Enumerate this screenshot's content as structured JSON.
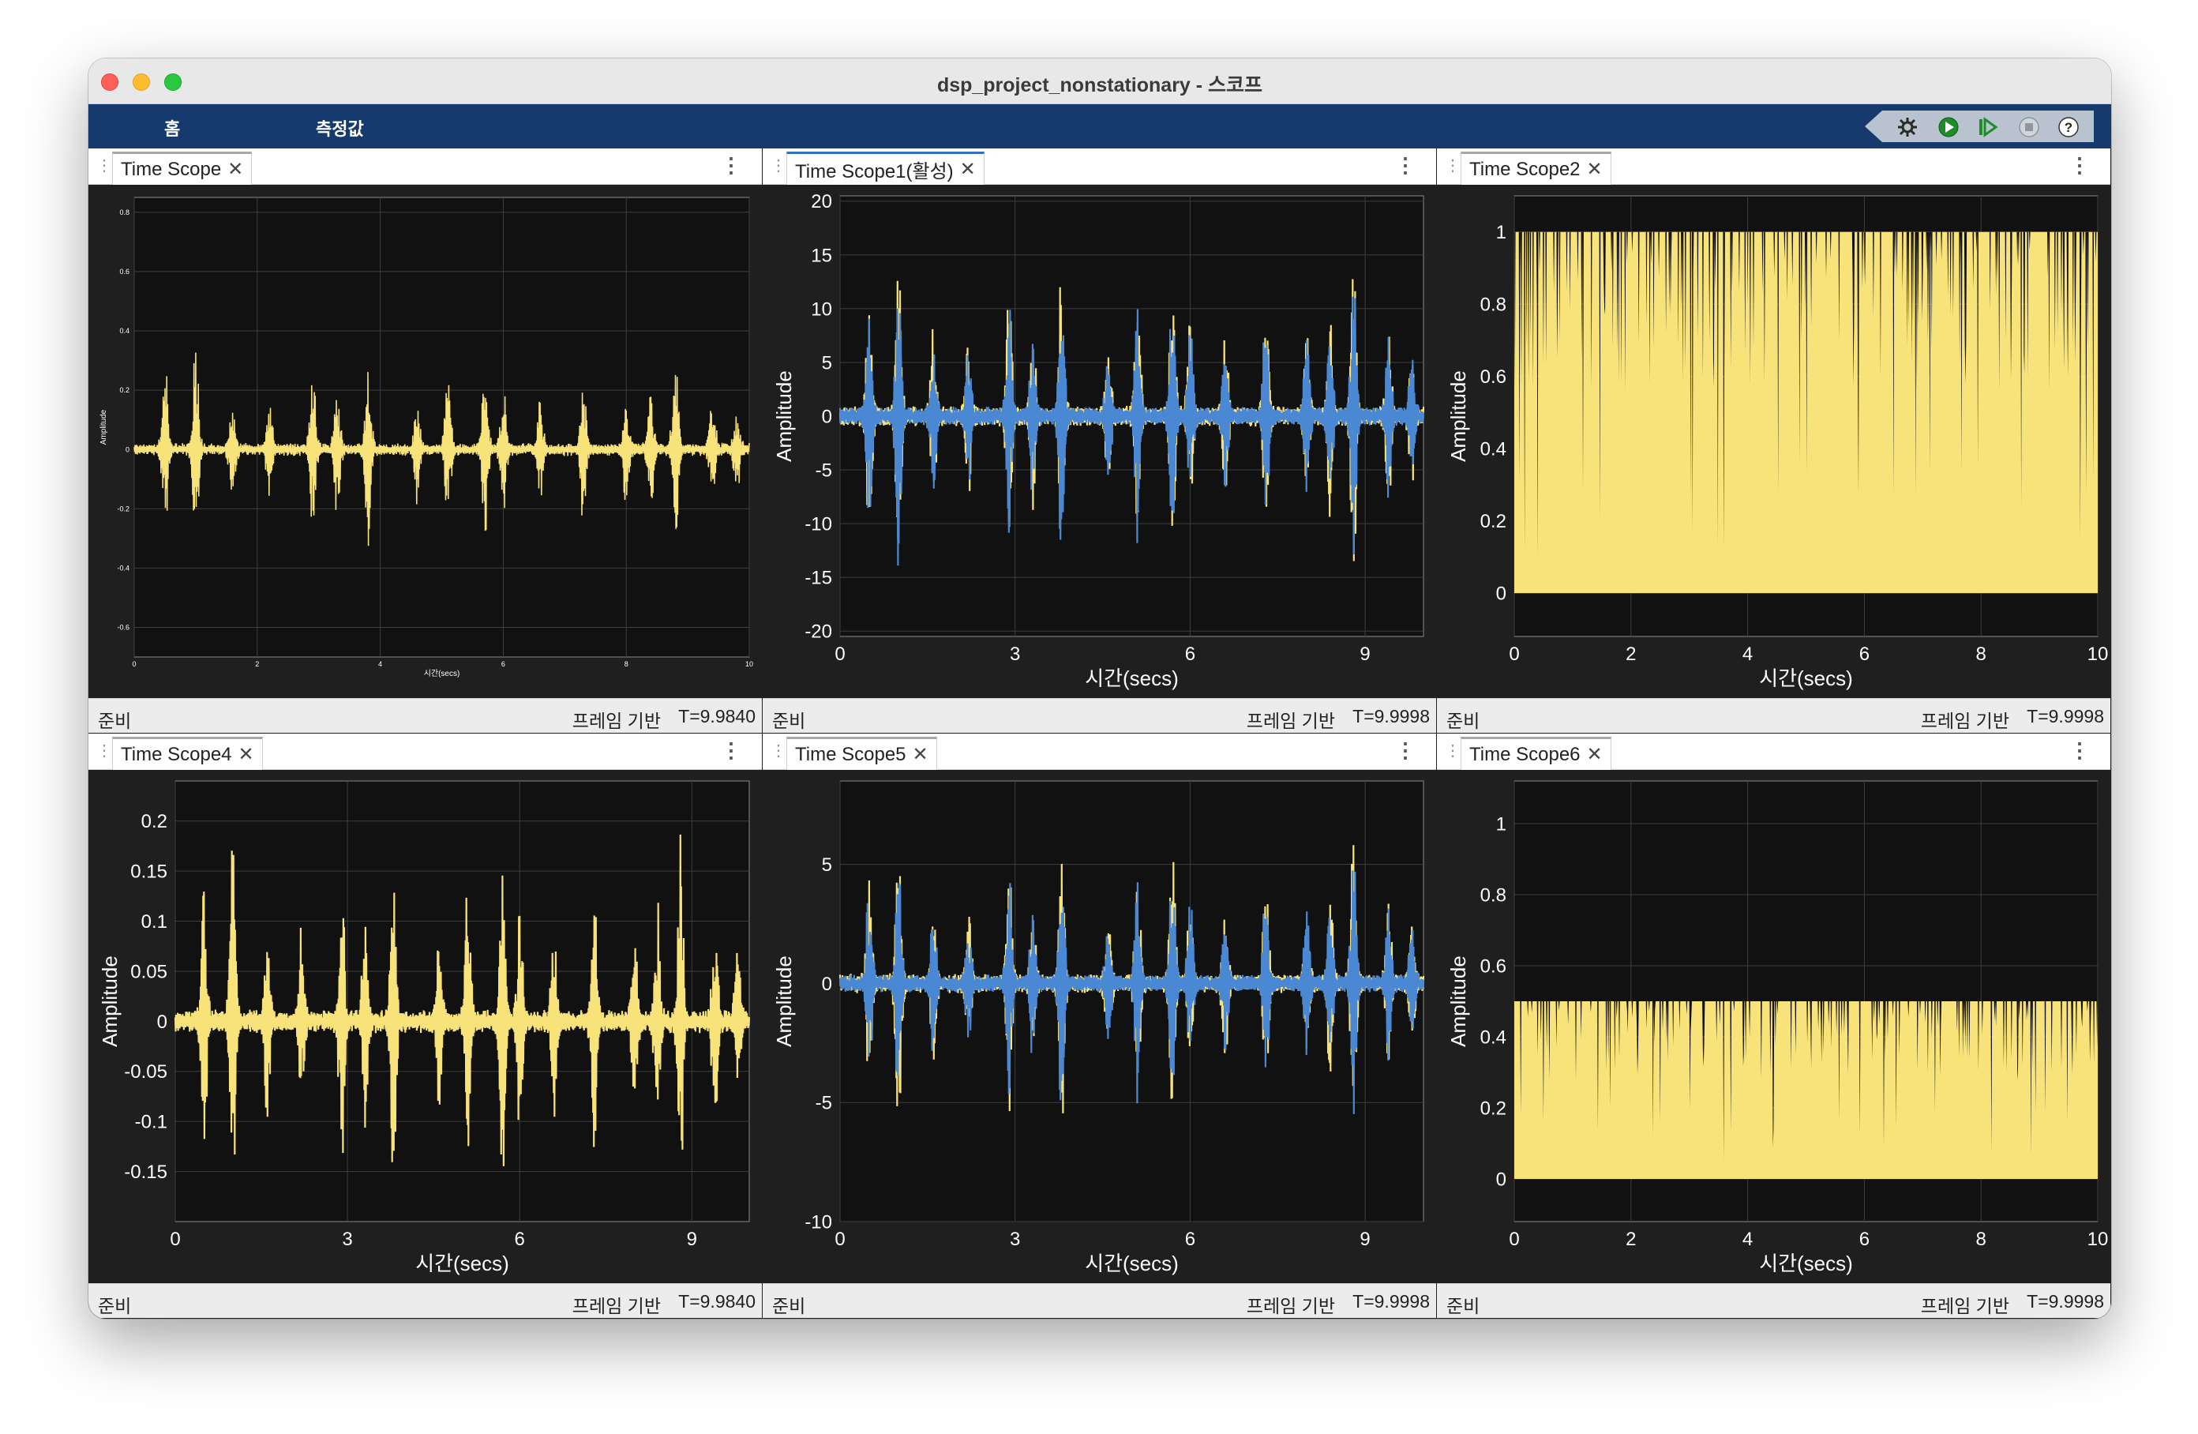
{
  "window": {
    "title": "dsp_project_nonstationary - 스코프"
  },
  "ribbon": {
    "tabs": [
      "홈",
      "측정값"
    ]
  },
  "panes": [
    {
      "tab": "Time Scope",
      "active": false,
      "status_left": "준비",
      "status_mode": "프레임 기반",
      "status_time": "T=9.9840"
    },
    {
      "tab": "Time Scope1(활성)",
      "active": true,
      "status_left": "준비",
      "status_mode": "프레임 기반",
      "status_time": "T=9.9998"
    },
    {
      "tab": "Time Scope2",
      "active": false,
      "status_left": "준비",
      "status_mode": "프레임 기반",
      "status_time": "T=9.9998"
    },
    {
      "tab": "Time Scope4",
      "active": false,
      "status_left": "준비",
      "status_mode": "프레임 기반",
      "status_time": "T=9.9840"
    },
    {
      "tab": "Time Scope5",
      "active": false,
      "status_left": "준비",
      "status_mode": "프레임 기반",
      "status_time": "T=9.9998"
    },
    {
      "tab": "Time Scope6",
      "active": false,
      "status_left": "준비",
      "status_mode": "프레임 기반",
      "status_time": "T=9.9998"
    }
  ],
  "colors": {
    "yellow": "#f8e27a",
    "blue": "#4a88d4",
    "plot_bg": "#111111",
    "axes_bg": "#1f1f1f",
    "grid": "#3e3e3e",
    "text": "#ffffff"
  },
  "chart_data": [
    {
      "type": "line",
      "signal": "speech",
      "xlabel": "시간(secs)",
      "ylabel": "Amplitude",
      "xlim": [
        0,
        10
      ],
      "ylim": [
        -0.7,
        0.85
      ],
      "xticks": [
        0,
        2,
        4,
        6,
        8,
        10
      ],
      "yticks": [
        -0.6,
        -0.4,
        -0.2,
        0,
        0.2,
        0.4,
        0.6,
        0.8
      ],
      "ytick_labels": [
        "-0.6",
        "-0.4",
        "-0.2",
        "0",
        "0.2",
        "0.4",
        "0.6",
        "0.8"
      ],
      "series": [
        {
          "color": "yellow",
          "envelope": 0.38
        }
      ]
    },
    {
      "type": "line",
      "signal": "speech",
      "xlabel": "시간(secs)",
      "ylabel": "Amplitude",
      "xlim": [
        0,
        10
      ],
      "ylim": [
        -20.5,
        20.5
      ],
      "xticks": [
        0,
        3,
        6,
        9
      ],
      "yticks": [
        -20,
        -15,
        -10,
        -5,
        0,
        5,
        10,
        15,
        20
      ],
      "ytick_labels": [
        "-20",
        "-15",
        "-10",
        "-5",
        "0",
        "5",
        "10",
        "15",
        "20"
      ],
      "series": [
        {
          "color": "yellow",
          "envelope": 16.5
        },
        {
          "color": "blue",
          "envelope": 15
        }
      ]
    },
    {
      "type": "area",
      "signal": "mask",
      "xlabel": "시간(secs)",
      "ylabel": "Amplitude",
      "xlim": [
        0,
        10
      ],
      "ylim": [
        -0.12,
        1.1
      ],
      "level": 1.0,
      "xticks": [
        0,
        2,
        4,
        6,
        8,
        10
      ],
      "yticks": [
        0,
        0.2,
        0.4,
        0.6,
        0.8,
        1
      ],
      "ytick_labels": [
        "0",
        "0.2",
        "0.4",
        "0.6",
        "0.8",
        "1"
      ],
      "series": [
        {
          "color": "yellow"
        }
      ]
    },
    {
      "type": "line",
      "signal": "speech",
      "xlabel": "시간(secs)",
      "ylabel": "Amplitude",
      "xlim": [
        0,
        10
      ],
      "ylim": [
        -0.2,
        0.24
      ],
      "xticks": [
        0,
        3,
        6,
        9
      ],
      "yticks": [
        -0.15,
        -0.1,
        -0.05,
        0,
        0.05,
        0.1,
        0.15,
        0.2
      ],
      "ytick_labels": [
        "-0.15",
        "-0.1",
        "-0.05",
        "0",
        "0.05",
        "0.1",
        "0.15",
        "0.2"
      ],
      "series": [
        {
          "color": "yellow",
          "envelope": 0.2
        }
      ]
    },
    {
      "type": "line",
      "signal": "speech",
      "xlabel": "시간(secs)",
      "ylabel": "Amplitude",
      "xlim": [
        0,
        10
      ],
      "ylim": [
        -10,
        8.5
      ],
      "xticks": [
        0,
        3,
        6,
        9
      ],
      "yticks": [
        -10,
        -5,
        0,
        5
      ],
      "ytick_labels": [
        "-10",
        "-5",
        "0",
        "5"
      ],
      "series": [
        {
          "color": "yellow",
          "envelope": 7
        },
        {
          "color": "blue",
          "envelope": 6.4
        }
      ]
    },
    {
      "type": "area",
      "signal": "mask",
      "xlabel": "시간(secs)",
      "ylabel": "Amplitude",
      "xlim": [
        0,
        10
      ],
      "ylim": [
        -0.12,
        1.12
      ],
      "level": 0.5,
      "xticks": [
        0,
        2,
        4,
        6,
        8,
        10
      ],
      "yticks": [
        0,
        0.2,
        0.4,
        0.6,
        0.8,
        1
      ],
      "ytick_labels": [
        "0",
        "0.2",
        "0.4",
        "0.6",
        "0.8",
        "1"
      ],
      "series": [
        {
          "color": "yellow"
        }
      ]
    }
  ]
}
